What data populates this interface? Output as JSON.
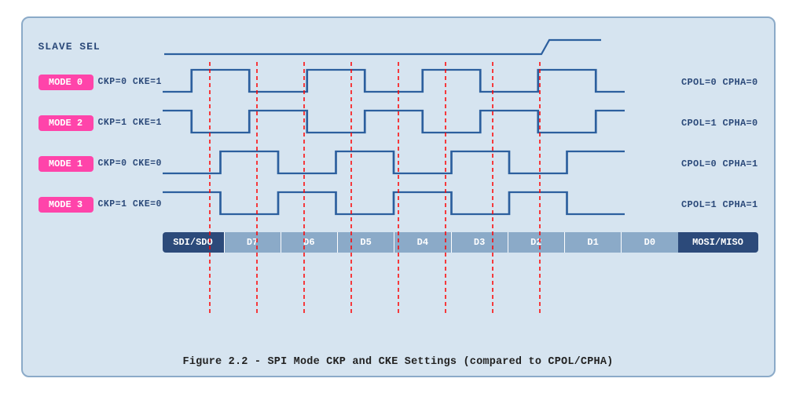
{
  "diagram": {
    "title": "Figure 2.2 - SPI Mode CKP and CKE Settings (compared to CPOL/CPHA)",
    "slave_sel_label": "SLAVE SEL",
    "modes": [
      {
        "badge": "MODE 0",
        "ckp": "CKP=0 CKE=1",
        "cpol": "CPOL=0 CPHA=0",
        "wave_type": "mode0"
      },
      {
        "badge": "MODE 2",
        "ckp": "CKP=1 CKE=1",
        "cpol": "CPOL=1 CPHA=0",
        "wave_type": "mode2"
      },
      {
        "badge": "MODE 1",
        "ckp": "CKP=0 CKE=0",
        "cpol": "CPOL=0 CPHA=1",
        "wave_type": "mode1"
      },
      {
        "badge": "MODE 3",
        "ckp": "CKP=1 CKE=0",
        "cpol": "CPOL=1 CPHA=1",
        "wave_type": "mode3"
      }
    ],
    "data_bits": [
      "D7",
      "D6",
      "D5",
      "D4",
      "D3",
      "D2",
      "D1",
      "D0"
    ],
    "sdi_label": "SDI/SDO",
    "mosi_label": "MOSI/MISO"
  }
}
